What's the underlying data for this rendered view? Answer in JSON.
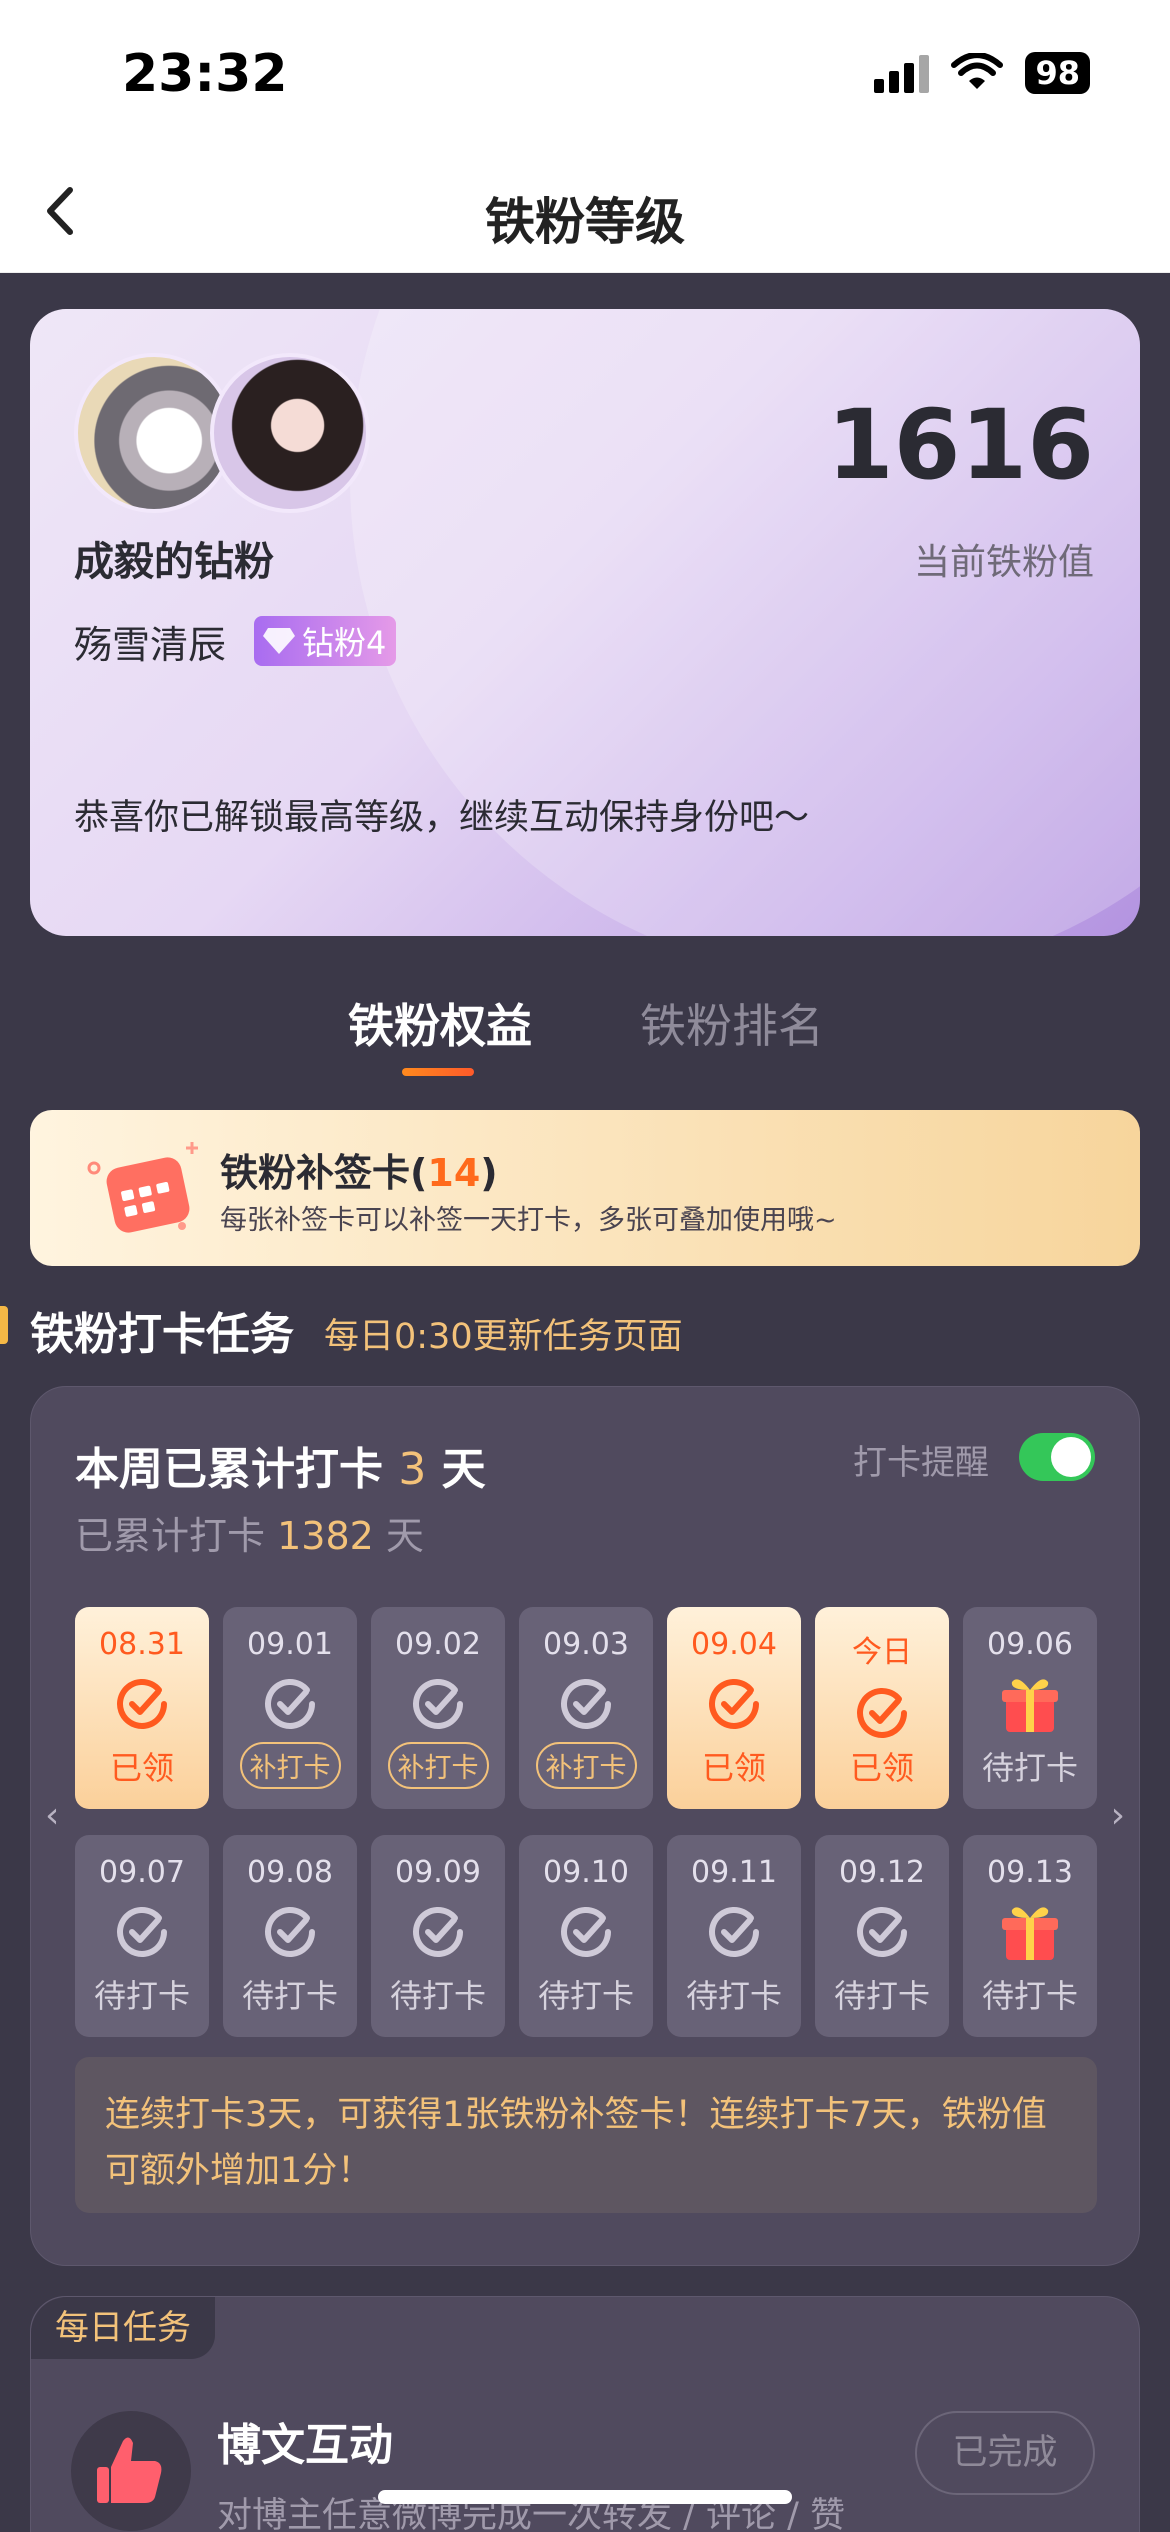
{
  "status": {
    "time": "23:32",
    "battery": "98"
  },
  "nav": {
    "title": "铁粉等级"
  },
  "hero": {
    "fan_name": "成毅的钻粉",
    "user_name": "殇雪清辰",
    "badge": "钻粉4",
    "score": "1616",
    "score_label": "当前铁粉值",
    "message": "恭喜你已解锁最高等级，继续互动保持身份吧～"
  },
  "tabs": [
    {
      "label": "铁粉权益",
      "active": true
    },
    {
      "label": "铁粉排名",
      "active": false
    }
  ],
  "supplement": {
    "title": "铁粉补签卡(",
    "count": "14",
    "close": ")",
    "desc": "每张补签卡可以补签一天打卡，多张可叠加使用哦~"
  },
  "section": {
    "title": "铁粉打卡任务",
    "subtitle": "每日0:30更新任务页面"
  },
  "checkin": {
    "week_prefix": "本周已累计打卡",
    "week_count": "3",
    "week_suffix": "天",
    "total_prefix": "已累计打卡",
    "total_count": "1382",
    "total_suffix": "天",
    "remind_label": "打卡提醒",
    "remind_on": true,
    "days": [
      {
        "date": "08.31",
        "status": "已领",
        "type": "done"
      },
      {
        "date": "09.01",
        "status": "补打卡",
        "type": "makeup"
      },
      {
        "date": "09.02",
        "status": "补打卡",
        "type": "makeup"
      },
      {
        "date": "09.03",
        "status": "补打卡",
        "type": "makeup"
      },
      {
        "date": "09.04",
        "status": "已领",
        "type": "done"
      },
      {
        "date": "今日",
        "status": "已领",
        "type": "done"
      },
      {
        "date": "09.06",
        "status": "待打卡",
        "type": "gift"
      },
      {
        "date": "09.07",
        "status": "待打卡",
        "type": "pending"
      },
      {
        "date": "09.08",
        "status": "待打卡",
        "type": "pending"
      },
      {
        "date": "09.09",
        "status": "待打卡",
        "type": "pending"
      },
      {
        "date": "09.10",
        "status": "待打卡",
        "type": "pending"
      },
      {
        "date": "09.11",
        "status": "待打卡",
        "type": "pending"
      },
      {
        "date": "09.12",
        "status": "待打卡",
        "type": "pending"
      },
      {
        "date": "09.13",
        "status": "待打卡",
        "type": "gift"
      }
    ],
    "note": "连续打卡3天，可获得1张铁粉补签卡！连续打卡7天，铁粉值可额外增加1分！"
  },
  "daily": {
    "tag": "每日任务",
    "title": "博文互动",
    "desc": "对博主任意微博完成一次转发 / 评论 / 赞",
    "button": "已完成"
  },
  "colors": {
    "accent": "#ff5a1f",
    "gold": "#f3c27a",
    "bg": "#3b3848",
    "card": "#504a5e"
  }
}
